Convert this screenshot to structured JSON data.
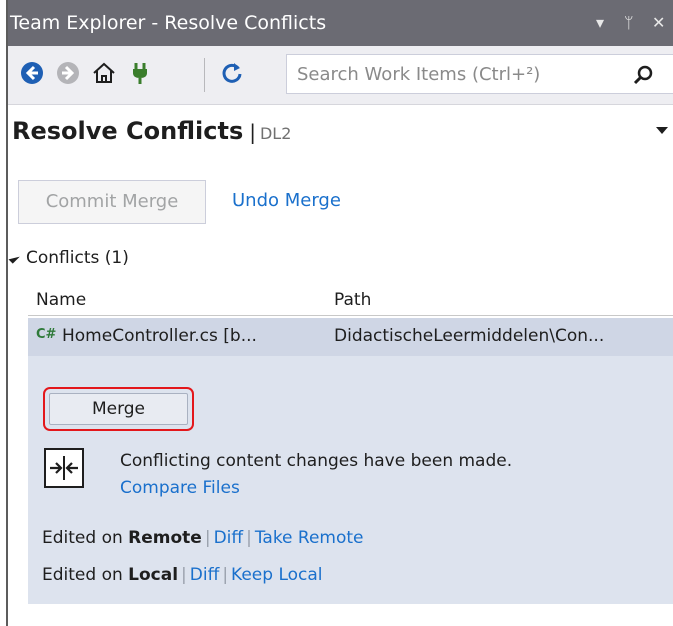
{
  "window": {
    "title": "Team Explorer - Resolve Conflicts",
    "ctrl_dropdown": "▾",
    "ctrl_pin": "ᛘ",
    "ctrl_close": "✕"
  },
  "toolbar": {
    "icons": [
      "back-icon",
      "forward-icon",
      "home-icon",
      "connect-icon",
      "refresh-icon",
      "search-icon"
    ],
    "search_placeholder": "Search Work Items (Ctrl+²)"
  },
  "header": {
    "title": "Resolve Conflicts",
    "separator": "|",
    "subtitle": "DL2"
  },
  "actions": {
    "commit_merge": "Commit Merge",
    "undo_merge": "Undo Merge"
  },
  "conflicts": {
    "section_label": "Conflicts (1)",
    "columns": {
      "name": "Name",
      "path": "Path"
    },
    "rows": [
      {
        "badge": "C#",
        "file": "HomeController.cs [b...",
        "path": "DidactischeLeermiddelen\\Con..."
      }
    ],
    "detail": {
      "merge_button": "Merge",
      "message": "Conflicting content changes have been made.",
      "compare_files": "Compare Files",
      "remote": {
        "prefix": "Edited on ",
        "side": "Remote",
        "diff": "Diff",
        "take": "Take Remote"
      },
      "local": {
        "prefix": "Edited on ",
        "side": "Local",
        "diff": "Diff",
        "keep": "Keep Local"
      },
      "divider": "|"
    }
  },
  "colors": {
    "title_bg": "#6b6b73",
    "link": "#1a70cc",
    "selected_row": "#cfd6e5",
    "highlight_outline": "#e3171b"
  }
}
